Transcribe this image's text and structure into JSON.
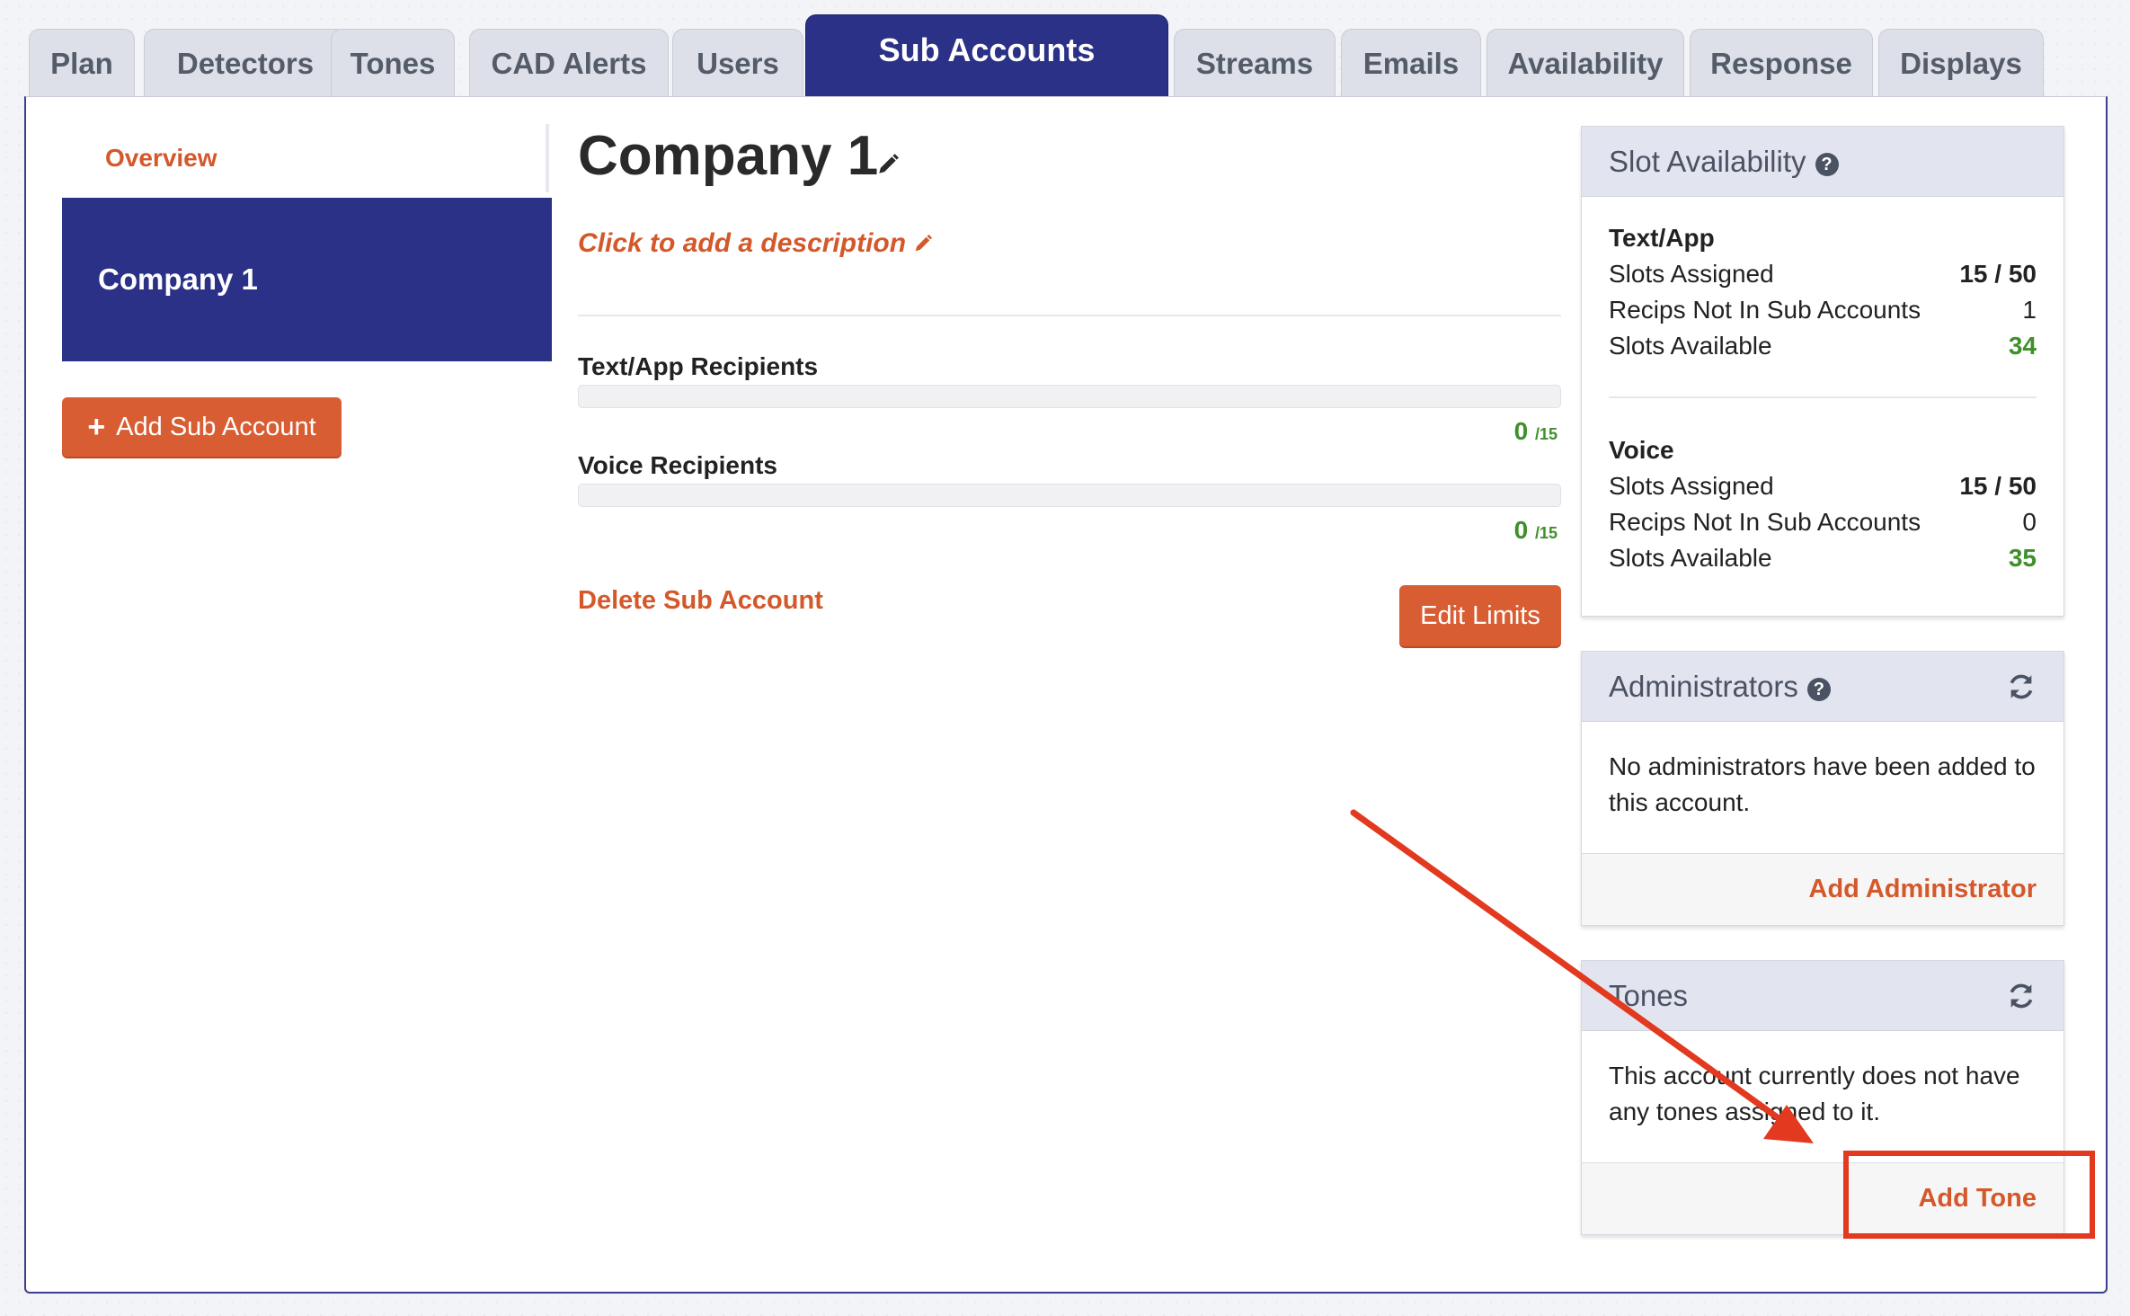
{
  "tabs": [
    {
      "label": "Plan",
      "active": false
    },
    {
      "label": "Detectors",
      "active": false
    },
    {
      "label": "Tones",
      "active": false
    },
    {
      "label": "CAD Alerts",
      "active": false
    },
    {
      "label": "Users",
      "active": false
    },
    {
      "label": "Sub Accounts",
      "active": true
    },
    {
      "label": "Streams",
      "active": false
    },
    {
      "label": "Emails",
      "active": false
    },
    {
      "label": "Availability",
      "active": false
    },
    {
      "label": "Response",
      "active": false
    },
    {
      "label": "Displays",
      "active": false
    }
  ],
  "sidebar": {
    "overview_label": "Overview",
    "selected_account": "Company 1",
    "add_button_label": "Add Sub Account",
    "add_button_icon": "plus-icon"
  },
  "main": {
    "title": "Company 1",
    "title_edit_icon": "pencil-icon",
    "description_placeholder": "Click to add a description",
    "text_app": {
      "label": "Text/App Recipients",
      "count": "0",
      "limit": "/15",
      "fill": 0
    },
    "voice": {
      "label": "Voice Recipients",
      "count": "0",
      "limit": "/15",
      "fill": 0
    },
    "delete_label": "Delete Sub Account",
    "edit_limits_label": "Edit Limits"
  },
  "slot_availability": {
    "title": "Slot Availability",
    "help_icon": "question-circle-icon",
    "text_app": {
      "heading": "Text/App",
      "slots_assigned_label": "Slots Assigned",
      "slots_assigned_value": "15 / 50",
      "recips_label": "Recips Not In Sub Accounts",
      "recips_value": "1",
      "slots_available_label": "Slots Available",
      "slots_available_value": "34"
    },
    "voice": {
      "heading": "Voice",
      "slots_assigned_label": "Slots Assigned",
      "slots_assigned_value": "15 / 50",
      "recips_label": "Recips Not In Sub Accounts",
      "recips_value": "0",
      "slots_available_label": "Slots Available",
      "slots_available_value": "35"
    }
  },
  "administrators": {
    "title": "Administrators",
    "help_icon": "question-circle-icon",
    "refresh_icon": "refresh-icon",
    "empty_text": "No administrators have been added to this account.",
    "add_label": "Add Administrator"
  },
  "tones": {
    "title": "Tones",
    "refresh_icon": "refresh-icon",
    "empty_text": "This account currently does not have any tones assigned to it.",
    "add_label": "Add Tone"
  },
  "colors": {
    "brand_navy": "#2a3187",
    "accent_orange": "#d85d33",
    "success_green": "#3f8f2b",
    "annotation_red": "#e2391f"
  }
}
